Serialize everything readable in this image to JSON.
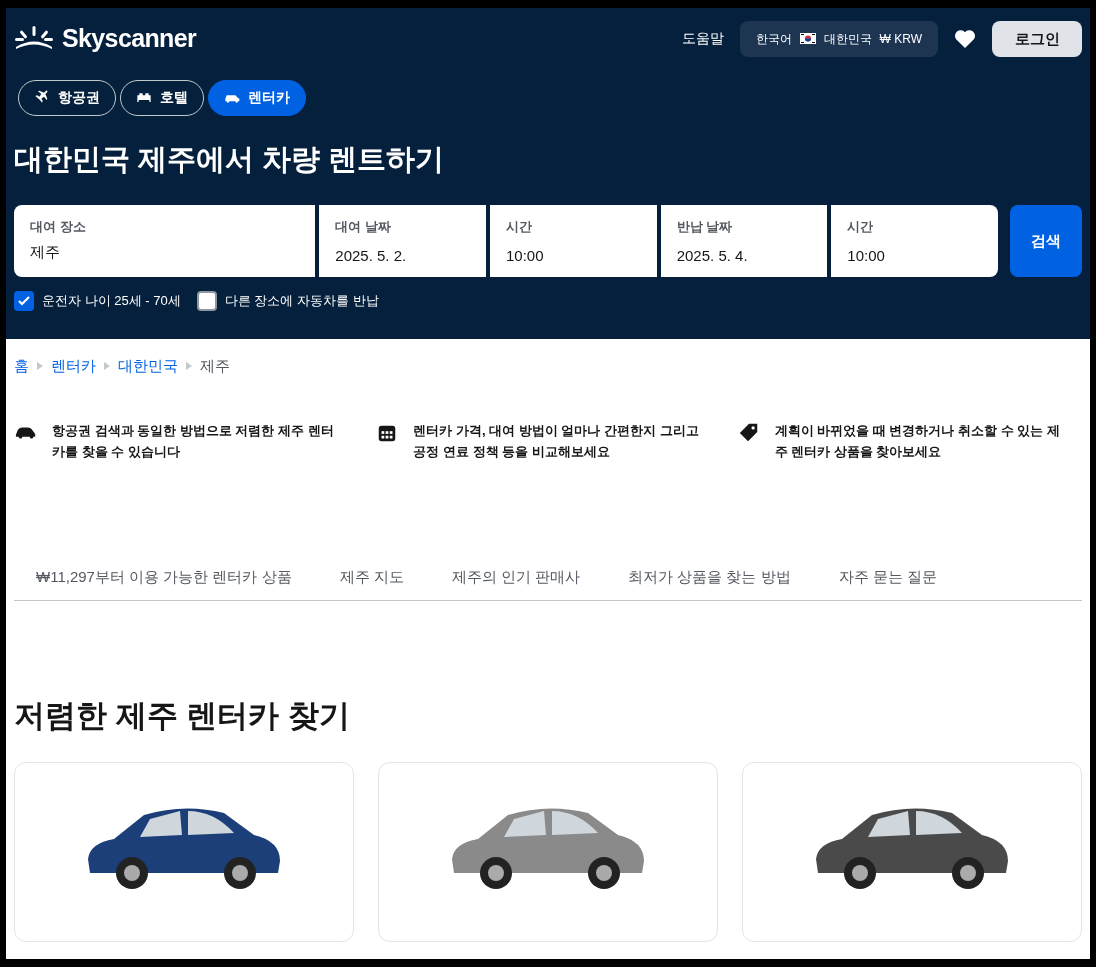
{
  "header": {
    "logo": "Skyscanner",
    "help": "도움말",
    "locale": {
      "language": "한국어",
      "country": "대한민국",
      "currency": "₩ KRW"
    },
    "login": "로그인"
  },
  "tabs": [
    {
      "label": "항공권",
      "kind": "plane",
      "selected": false
    },
    {
      "label": "호텔",
      "kind": "bed",
      "selected": false
    },
    {
      "label": "렌터카",
      "kind": "car",
      "selected": true
    }
  ],
  "title": "대한민국 제주에서 차량 렌트하기",
  "search": {
    "fields": [
      {
        "label": "대여 장소",
        "value": "제주"
      },
      {
        "label": "대여 날짜",
        "value": "2025. 5. 2."
      },
      {
        "label": "시간",
        "value": "10:00"
      },
      {
        "label": "반납 날짜",
        "value": "2025. 5. 4."
      },
      {
        "label": "시간",
        "value": "10:00"
      }
    ],
    "button": "검색",
    "options": [
      {
        "label": "운전자 나이 25세 - 70세",
        "checked": true
      },
      {
        "label": "다른 장소에 자동차를 반납",
        "checked": false
      }
    ]
  },
  "breadcrumb": [
    {
      "label": "홈",
      "link": true
    },
    {
      "label": "렌터카",
      "link": true
    },
    {
      "label": "대한민국",
      "link": true
    },
    {
      "label": "제주",
      "link": false
    }
  ],
  "features": [
    {
      "kind": "car",
      "text": "항공권 검색과 동일한 방법으로 저렴한 제주 렌터카를 찾을 수 있습니다"
    },
    {
      "kind": "calendar",
      "text": "렌터카 가격, 대여 방법이 얼마나 간편한지 그리고 공정 연료 정책 등을 비교해보세요"
    },
    {
      "kind": "tag",
      "text": "계획이 바뀌었을 때 변경하거나 취소할 수 있는 제주 렌터카 상품을 찾아보세요"
    }
  ],
  "section_nav": [
    "₩11,297부터 이용 가능한 렌터카 상품",
    "제주 지도",
    "제주의 인기 판매사",
    "최저가 상품을 찾는 방법",
    "자주 묻는 질문"
  ],
  "deals": {
    "heading": "저렴한 제주 렌터카 찾기",
    "cards": [
      {
        "color": "#1c3f7a"
      },
      {
        "color": "#8a8a8a"
      },
      {
        "color": "#4a4a4a"
      }
    ]
  }
}
